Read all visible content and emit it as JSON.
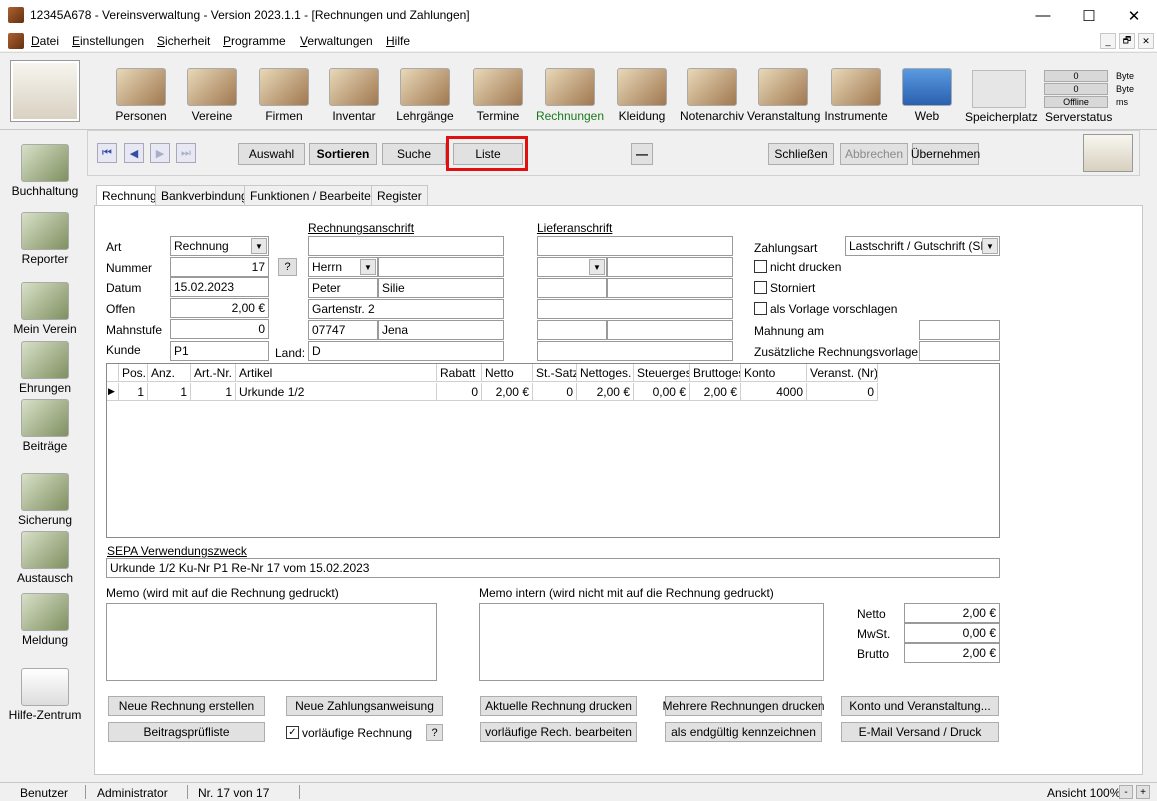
{
  "window": {
    "title": "12345A678 - Vereinsverwaltung - Version 2023.1.1 - [Rechnungen und Zahlungen]",
    "min": "—",
    "max": "☐",
    "close": "✕"
  },
  "menu": [
    "Datei",
    "Einstellungen",
    "Sicherheit",
    "Programme",
    "Verwaltungen",
    "Hilfe"
  ],
  "menu_accel": [
    "D",
    "E",
    "S",
    "P",
    "V",
    "H"
  ],
  "menu_rest": [
    "atei",
    "instellungen",
    "icherheit",
    "rogramme",
    "erwaltungen",
    "ilfe"
  ],
  "mdi": {
    "min": "_",
    "restore": "🗗",
    "close": "✕"
  },
  "toolbar": {
    "items": [
      {
        "label": "Personen"
      },
      {
        "label": "Vereine"
      },
      {
        "label": "Firmen"
      },
      {
        "label": "Inventar"
      },
      {
        "label": "Lehrgänge"
      },
      {
        "label": "Termine"
      },
      {
        "label": "Rechnungen"
      },
      {
        "label": "Kleidung"
      },
      {
        "label": "Notenarchiv"
      },
      {
        "label": "Veranstaltung"
      },
      {
        "label": "Instrumente"
      },
      {
        "label": "Web"
      }
    ],
    "speicherplatz": "Speicherplatz",
    "serverstatus": "Serverstatus",
    "server_vals": [
      "0",
      "0",
      "Offline"
    ],
    "server_units": [
      "Byte",
      "Byte",
      "ms"
    ]
  },
  "sidebar": [
    "Buchhaltung",
    "Reporter",
    "Mein Verein",
    "Ehrungen",
    "Beiträge",
    "Sicherung",
    "Austausch",
    "Meldung",
    "Hilfe-Zentrum"
  ],
  "nav": {
    "first": "⏮",
    "prev": "◀",
    "next": "▶",
    "last": "⏭",
    "auswahl": "Auswahl",
    "sortieren": "Sortieren",
    "suche": "Suche",
    "liste": "Liste",
    "minus": "—",
    "schliessen": "Schließen",
    "abbrechen": "Abbrechen",
    "uebernehmen": "Übernehmen"
  },
  "tabs": [
    "Rechnung",
    "Bankverbindung",
    "Funktionen / Bearbeiten",
    "Register"
  ],
  "form": {
    "art_label": "Art",
    "art": "Rechnung",
    "nummer_label": "Nummer",
    "nummer": "17",
    "help": "?",
    "datum_label": "Datum",
    "datum": "15.02.2023",
    "offen_label": "Offen",
    "offen": "2,00 €",
    "mahnstufe_label": "Mahnstufe",
    "mahnstufe": "0",
    "kunde_label": "Kunde",
    "kunde": "P1",
    "land_label": "Land:",
    "land": "D",
    "rechnungsanschrift": "Rechnungsanschrift",
    "anrede": "Herrn",
    "vorname": "Peter",
    "nachname": "Silie",
    "strasse": "Gartenstr. 2",
    "plz": "07747",
    "ort": "Jena",
    "lieferanschrift": "Lieferanschrift",
    "zahlungsart_label": "Zahlungsart",
    "zahlungsart": "Lastschrift / Gutschrift (SEP",
    "nicht_drucken": "nicht drucken",
    "storniert": "Storniert",
    "vorlage": "als Vorlage vorschlagen",
    "mahnung_am": "Mahnung am",
    "zus_vorlage": "Zusätzliche Rechnungsvorlage"
  },
  "grid": {
    "headers": [
      "Pos.",
      "Anz.",
      "Art.-Nr.",
      "Artikel",
      "Rabatt",
      "Netto",
      "St.-Satz",
      "Nettoges.",
      "Steuerges.",
      "Bruttoges",
      "Konto",
      "Veranst. (Nr)"
    ],
    "rows": [
      [
        "1",
        "1",
        "1",
        "Urkunde 1/2",
        "0",
        "2,00 €",
        "0",
        "2,00 €",
        "0,00 €",
        "2,00 €",
        "4000",
        "0"
      ]
    ],
    "row_marker": "▶"
  },
  "sepa": {
    "label": "SEPA Verwendungszweck",
    "value": "Urkunde 1/2 Ku-Nr P1 Re-Nr 17 vom 15.02.2023"
  },
  "memo": {
    "label": "Memo (wird mit auf die Rechnung gedruckt)",
    "intern_label": "Memo intern (wird nicht mit auf die Rechnung gedruckt)"
  },
  "totals": {
    "netto_label": "Netto",
    "netto": "2,00 €",
    "mwst_label": "MwSt.",
    "mwst": "0,00 €",
    "brutto_label": "Brutto",
    "brutto": "2,00 €"
  },
  "actions": {
    "neue_rechnung": "Neue Rechnung erstellen",
    "neue_zahlung": "Neue Zahlungsanweisung",
    "aktuelle_drucken": "Aktuelle Rechnung drucken",
    "mehrere_drucken": "Mehrere Rechnungen drucken",
    "konto_veranst": "Konto und Veranstaltung...",
    "beitragspruef": "Beitragsprüfliste",
    "vorlaeufig": "vorläufige Rechnung",
    "vorlaeufig_help": "?",
    "vorlaeufig_bearb": "vorläufige Rech. bearbeiten",
    "endgueltig": "als endgültig kennzeichnen",
    "email": "E-Mail Versand / Druck"
  },
  "status": {
    "benutzer": "Benutzer",
    "user": "Administrator",
    "record": "Nr. 17 von 17",
    "ansicht": "Ansicht 100%",
    "minus": "-",
    "plus": "+"
  },
  "colors": {
    "highlight": "#e01010",
    "active_label": "#1a7a1a"
  }
}
